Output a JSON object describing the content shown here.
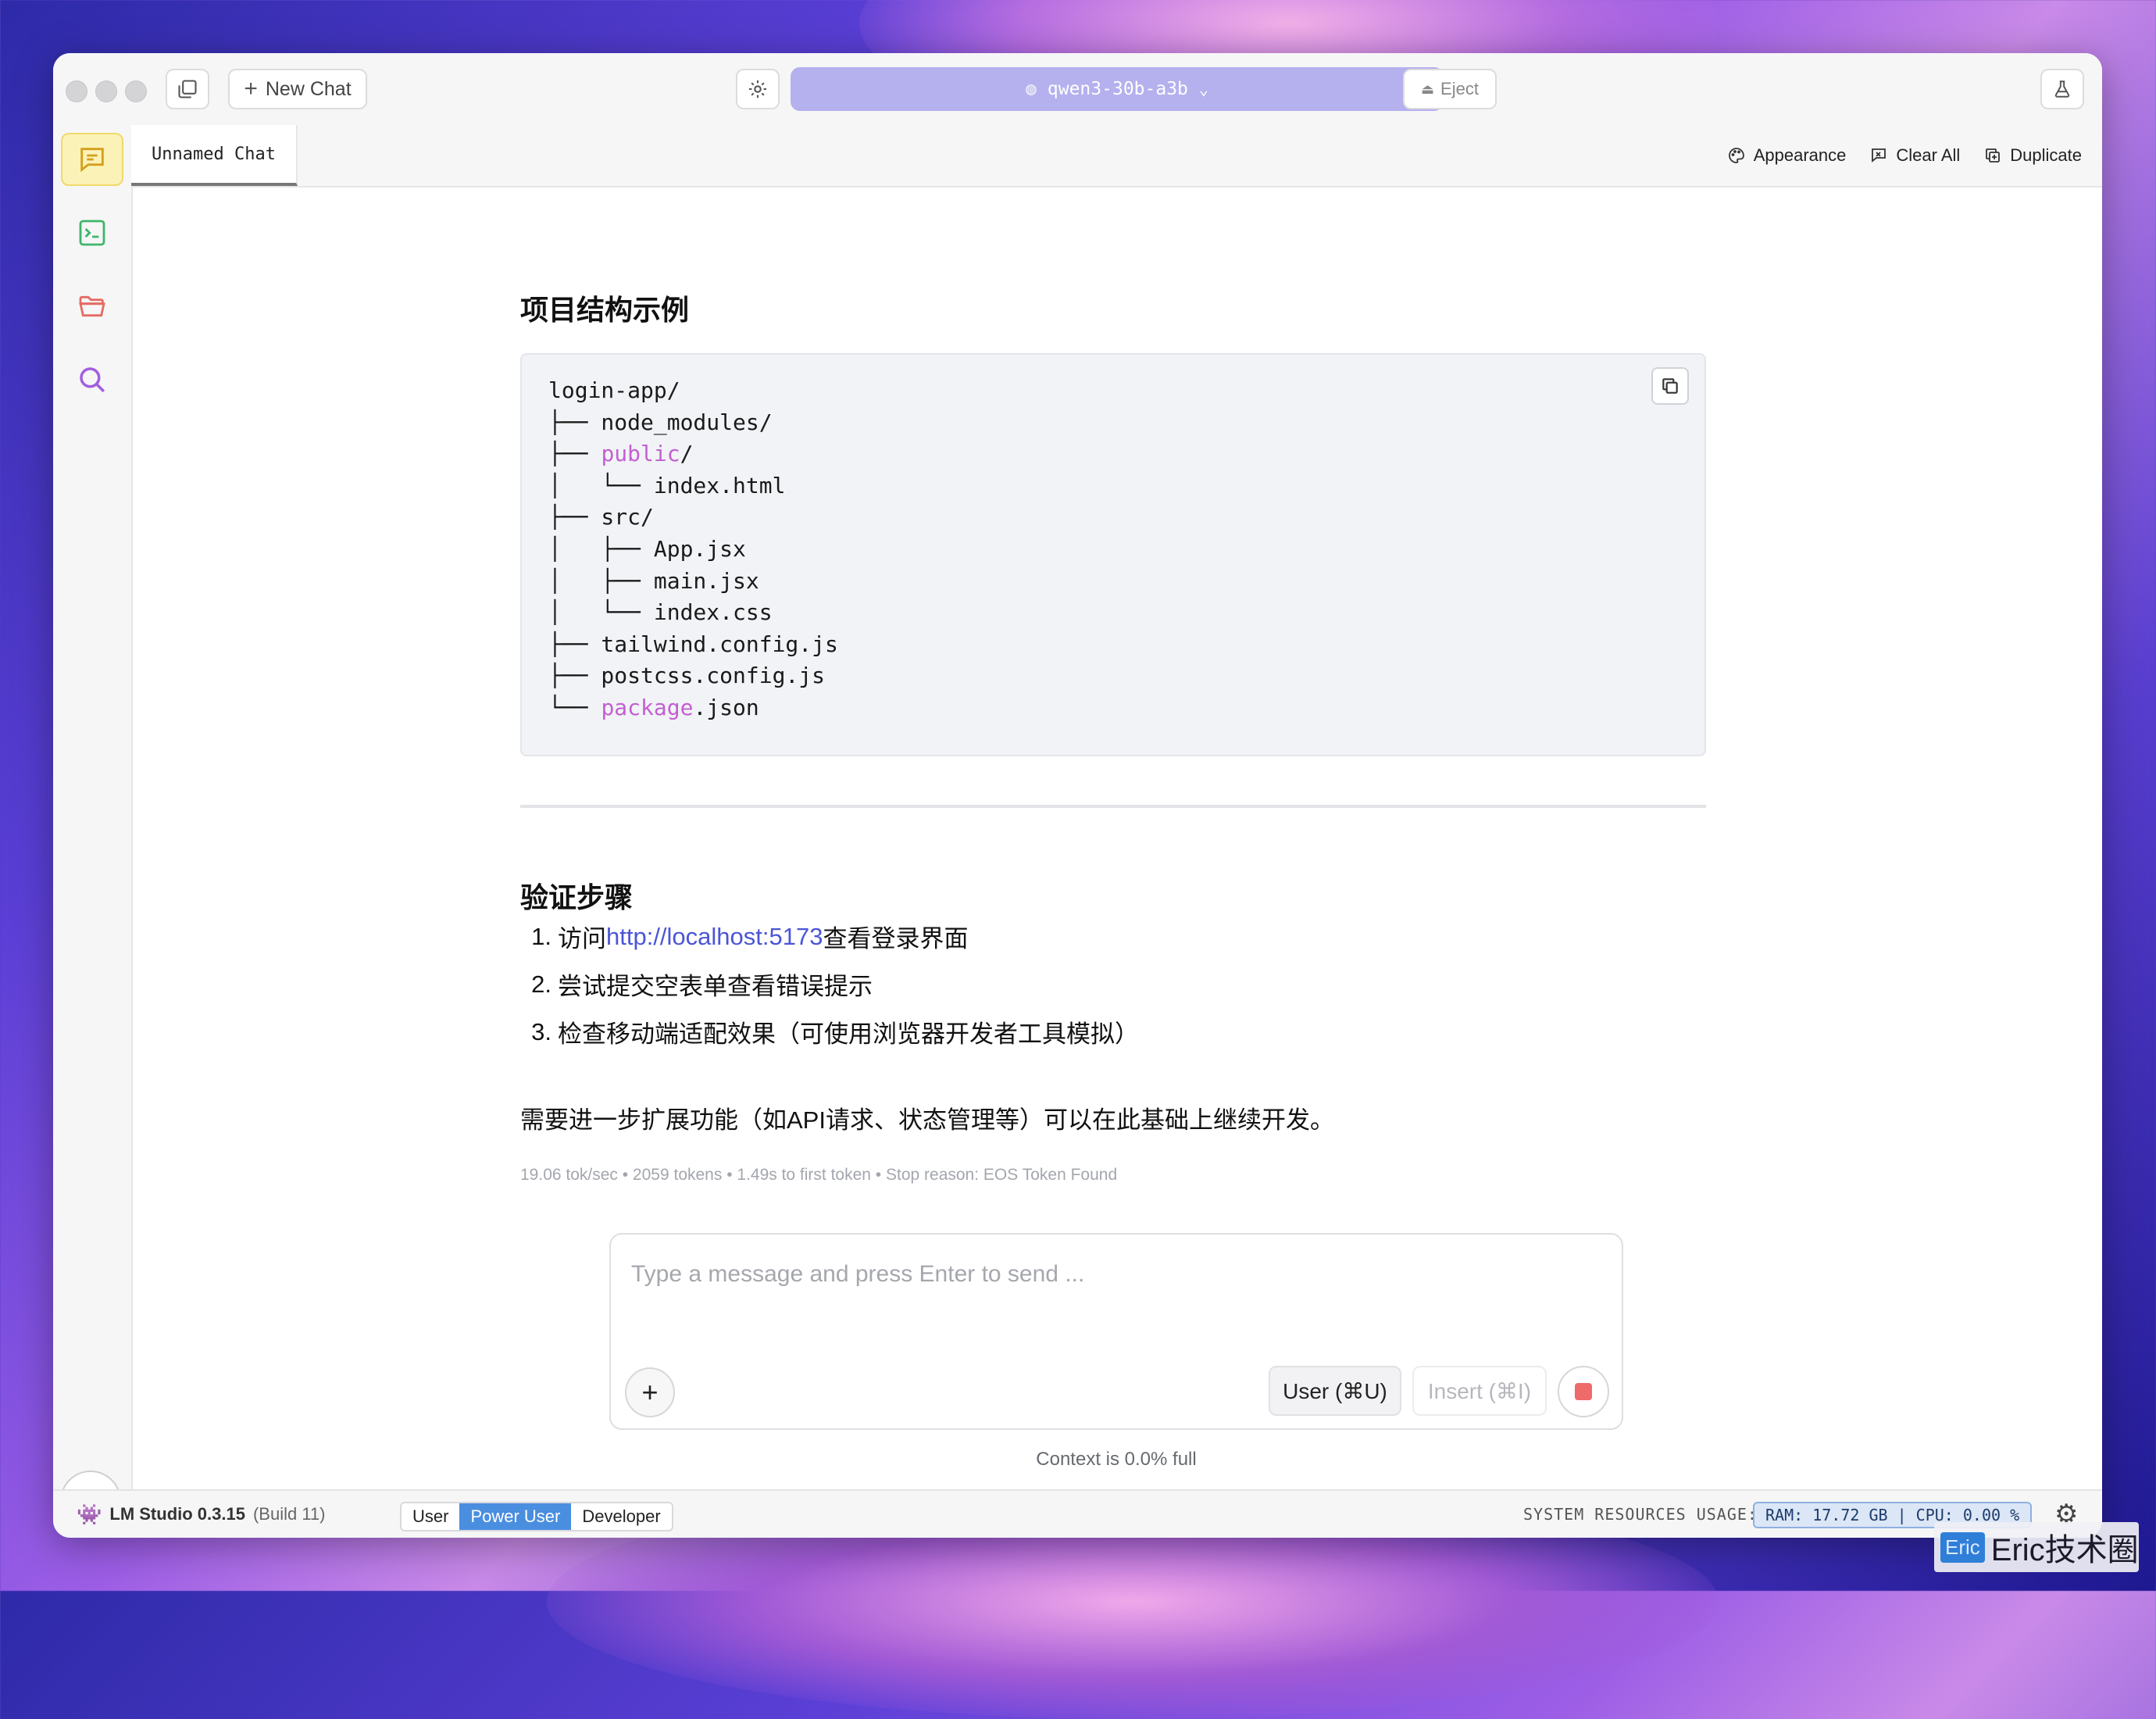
{
  "titlebar": {
    "new_chat_label": "New Chat",
    "model_name": "qwen3-30b-a3b",
    "eject_label": "Eject"
  },
  "tab": {
    "label": "Unnamed Chat"
  },
  "tab_actions": {
    "appearance": "Appearance",
    "clear_all": "Clear All",
    "duplicate": "Duplicate"
  },
  "content": {
    "heading1": "项目结构示例",
    "code_lines": [
      [
        {
          "t": "login-app/"
        }
      ],
      [
        {
          "t": "├── node_modules/"
        }
      ],
      [
        {
          "t": "├── "
        },
        {
          "t": "public",
          "hl": true
        },
        {
          "t": "/"
        }
      ],
      [
        {
          "t": "│   └── index.html"
        }
      ],
      [
        {
          "t": "├── src/"
        }
      ],
      [
        {
          "t": "│   ├── App.jsx"
        }
      ],
      [
        {
          "t": "│   ├── main.jsx"
        }
      ],
      [
        {
          "t": "│   └── index.css"
        }
      ],
      [
        {
          "t": "├── tailwind.config.js"
        }
      ],
      [
        {
          "t": "├── postcss.config.js"
        }
      ],
      [
        {
          "t": "└── "
        },
        {
          "t": "package",
          "hl": true
        },
        {
          "t": ".json"
        }
      ]
    ],
    "heading2": "验证步骤",
    "steps": [
      {
        "num": "1.",
        "pre": "访问 ",
        "link": "http://localhost:5173",
        "post": " 查看登录界面"
      },
      {
        "num": "2.",
        "pre": "尝试提交空表单查看错误提示",
        "link": "",
        "post": ""
      },
      {
        "num": "3.",
        "pre": "检查移动端适配效果（可使用浏览器开发者工具模拟）",
        "link": "",
        "post": ""
      }
    ],
    "paragraph": "需要进一步扩展功能（如API请求、状态管理等）可以在此基础上继续开发。",
    "stats": "19.06 tok/sec  •  2059 tokens  •  1.49s to first token  •  Stop reason: EOS Token Found"
  },
  "input": {
    "placeholder": "Type a message and press Enter to send ...",
    "value": "",
    "user_btn": "User (⌘U)",
    "insert_btn": "Insert (⌘I)"
  },
  "context_text": "Context is 0.0% full",
  "statusbar": {
    "app_name": "LM Studio 0.3.15",
    "build": "(Build 11)",
    "modes": [
      "User",
      "Power User",
      "Developer"
    ],
    "active_mode": "Power User",
    "resources_label": "SYSTEM RESOURCES USAGE:",
    "resources_value": "RAM: 17.72 GB  |  CPU: 0.00 %"
  },
  "watermark": {
    "logo": "Eric",
    "text": "Eric技术圈"
  },
  "colors": {
    "accent": "#b5b0ee",
    "highlight": "#c35fd1",
    "link": "#4b55d6",
    "active_mode": "#4a8ee0"
  }
}
